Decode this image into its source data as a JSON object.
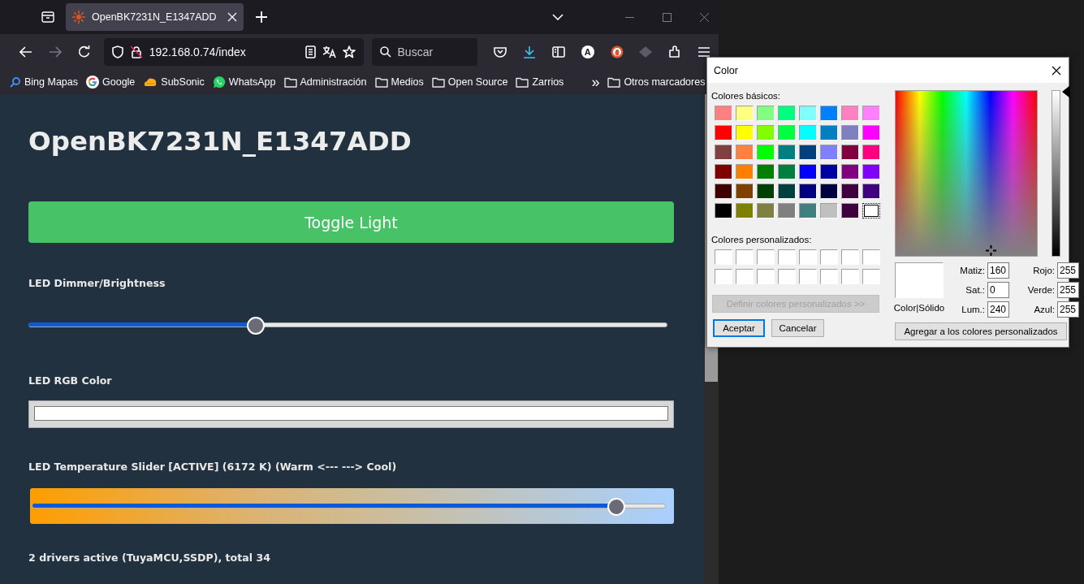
{
  "browser": {
    "tab": {
      "title": "OpenBK7231N_E1347ADD",
      "selected": true
    },
    "address": {
      "host": "192.168.0.74",
      "path": "/index"
    },
    "search": {
      "placeholder": "Buscar"
    },
    "account_initial": "A",
    "bookmarks": [
      {
        "kind": "search",
        "label": "Bing Mapas"
      },
      {
        "kind": "google",
        "label": "Google"
      },
      {
        "kind": "subsonic",
        "label": "SubSonic"
      },
      {
        "kind": "whatsapp",
        "label": "WhatsApp"
      },
      {
        "kind": "folder",
        "label": "Administración"
      },
      {
        "kind": "folder",
        "label": "Medios"
      },
      {
        "kind": "folder",
        "label": "Open Source"
      },
      {
        "kind": "folder",
        "label": "Zarrios"
      }
    ],
    "overflow": "»",
    "other_bookmarks": {
      "kind": "folder",
      "label": "Otros marcadores"
    }
  },
  "page": {
    "title": "OpenBK7231N_E1347ADD",
    "toggle_button": "Toggle Light",
    "dimmer": {
      "label": "LED Dimmer/Brightness",
      "level": 0.355
    },
    "rgb": {
      "label": "LED RGB Color",
      "color": "#ffffff"
    },
    "temperature": {
      "label": "LED Temperature Slider [ACTIVE] (6172 K) (Warm <--- ---> Cool)",
      "level": 0.92
    },
    "footer": "2 drivers active (TuyaMCU,SSDP), total 34"
  },
  "color_dialog": {
    "title": "Color",
    "basic_label": "Colores básicos:",
    "basic_colors": [
      {
        "color": "#ff8080",
        "selected": false
      },
      {
        "color": "#ffff80",
        "selected": false
      },
      {
        "color": "#80ff80",
        "selected": false
      },
      {
        "color": "#00ff80",
        "selected": false
      },
      {
        "color": "#80ffff",
        "selected": false
      },
      {
        "color": "#0080ff",
        "selected": false
      },
      {
        "color": "#ff80c0",
        "selected": false
      },
      {
        "color": "#ff80ff",
        "selected": false
      },
      {
        "color": "#ff0000",
        "selected": false
      },
      {
        "color": "#ffff00",
        "selected": false
      },
      {
        "color": "#80ff00",
        "selected": false
      },
      {
        "color": "#00ff40",
        "selected": false
      },
      {
        "color": "#00ffff",
        "selected": false
      },
      {
        "color": "#0080c0",
        "selected": false
      },
      {
        "color": "#8080c0",
        "selected": false
      },
      {
        "color": "#ff00ff",
        "selected": false
      },
      {
        "color": "#804040",
        "selected": false
      },
      {
        "color": "#ff8040",
        "selected": false
      },
      {
        "color": "#00ff00",
        "selected": false
      },
      {
        "color": "#008080",
        "selected": false
      },
      {
        "color": "#004080",
        "selected": false
      },
      {
        "color": "#8080ff",
        "selected": false
      },
      {
        "color": "#800040",
        "selected": false
      },
      {
        "color": "#ff0080",
        "selected": false
      },
      {
        "color": "#800000",
        "selected": false
      },
      {
        "color": "#ff8000",
        "selected": false
      },
      {
        "color": "#008000",
        "selected": false
      },
      {
        "color": "#008040",
        "selected": false
      },
      {
        "color": "#0000ff",
        "selected": false
      },
      {
        "color": "#0000a0",
        "selected": false
      },
      {
        "color": "#800080",
        "selected": false
      },
      {
        "color": "#8000ff",
        "selected": false
      },
      {
        "color": "#400000",
        "selected": false
      },
      {
        "color": "#804000",
        "selected": false
      },
      {
        "color": "#004000",
        "selected": false
      },
      {
        "color": "#004040",
        "selected": false
      },
      {
        "color": "#000080",
        "selected": false
      },
      {
        "color": "#000040",
        "selected": false
      },
      {
        "color": "#400040",
        "selected": false
      },
      {
        "color": "#400080",
        "selected": false
      },
      {
        "color": "#000000",
        "selected": false
      },
      {
        "color": "#808000",
        "selected": false
      },
      {
        "color": "#808040",
        "selected": false
      },
      {
        "color": "#808080",
        "selected": false
      },
      {
        "color": "#408080",
        "selected": false
      },
      {
        "color": "#c0c0c0",
        "selected": false
      },
      {
        "color": "#400040",
        "selected": false
      },
      {
        "color": "#ffffff",
        "selected": true
      }
    ],
    "custom_label": "Colores personalizados:",
    "custom_colors": [
      {
        "color": "#ffffff"
      },
      {
        "color": "#ffffff"
      },
      {
        "color": "#ffffff"
      },
      {
        "color": "#ffffff"
      },
      {
        "color": "#ffffff"
      },
      {
        "color": "#ffffff"
      },
      {
        "color": "#ffffff"
      },
      {
        "color": "#ffffff"
      },
      {
        "color": "#ffffff"
      },
      {
        "color": "#ffffff"
      },
      {
        "color": "#ffffff"
      },
      {
        "color": "#ffffff"
      },
      {
        "color": "#ffffff"
      },
      {
        "color": "#ffffff"
      },
      {
        "color": "#ffffff"
      },
      {
        "color": "#ffffff"
      }
    ],
    "define_button": {
      "label": "Definir colores personalizados >>",
      "disabled": true
    },
    "ok_button": "Aceptar",
    "cancel_button": "Cancelar",
    "preview": {
      "label": "Color|Sólido",
      "color": "#ffffff"
    },
    "hsl_fields": [
      {
        "label": "Matiz:",
        "value": "160"
      },
      {
        "label": "Sat.:",
        "value": "0"
      },
      {
        "label": "Lum.:",
        "value": "240"
      }
    ],
    "rgb_fields": [
      {
        "label": "Rojo:",
        "value": "255"
      },
      {
        "label": "Verde:",
        "value": "255"
      },
      {
        "label": "Azul:",
        "value": "255"
      }
    ],
    "add_button": "Agregar a los colores personalizados"
  }
}
